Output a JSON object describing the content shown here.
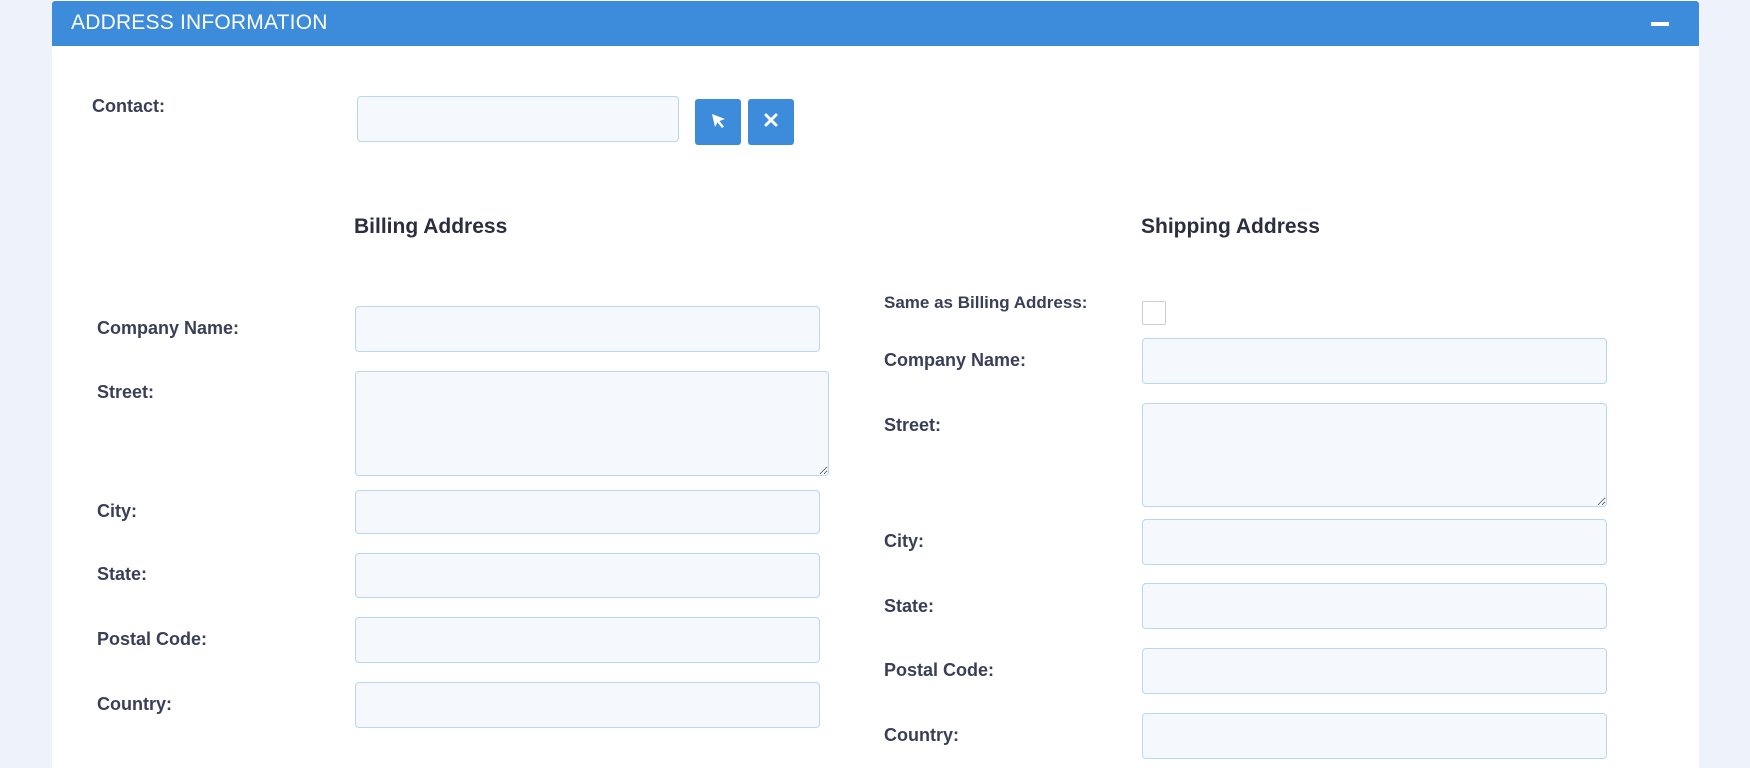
{
  "panel": {
    "title": "ADDRESS INFORMATION"
  },
  "contact": {
    "label": "Contact:",
    "value": ""
  },
  "billing": {
    "heading": "Billing Address",
    "company_label": "Company Name:",
    "street_label": "Street:",
    "city_label": "City:",
    "state_label": "State:",
    "postal_label": "Postal Code:",
    "country_label": "Country:"
  },
  "shipping": {
    "heading": "Shipping Address",
    "same_label": "Same as Billing Address:",
    "same_checked": false,
    "company_label": "Company Name:",
    "street_label": "Street:",
    "city_label": "City:",
    "state_label": "State:",
    "postal_label": "Postal Code:",
    "country_label": "Country:"
  },
  "icons": {
    "collapse": "minus-icon",
    "select": "cursor-arrow-icon",
    "clear": "close-icon"
  },
  "colors": {
    "accent": "#3d8bdb",
    "input_border": "#b9d7f2",
    "input_bg": "#f5f8fc",
    "label_text": "#3a3f58"
  }
}
